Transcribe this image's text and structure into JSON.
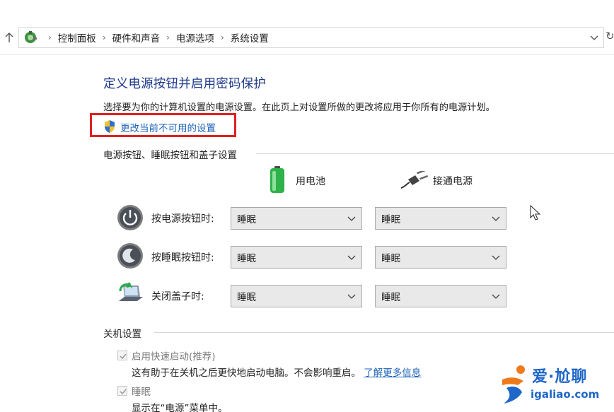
{
  "address_bar": {
    "breadcrumbs": [
      "控制面板",
      "硬件和声音",
      "电源选项",
      "系统设置"
    ]
  },
  "page": {
    "title": "定义电源按钮并启用密码保护",
    "description": "选择要为你的计算机设置的电源设置。在此页上对设置所做的更改将应用于你所有的电源计划。",
    "admin_link": "更改当前不可用的设置"
  },
  "power_buttons": {
    "heading": "电源按钮、睡眠按钮和盖子设置",
    "columns": {
      "battery": "用电池",
      "plugged_in": "接通电源"
    },
    "rows": [
      {
        "label": "按电源按钮时:",
        "battery": "睡眠",
        "plugged_in": "睡眠"
      },
      {
        "label": "按睡眠按钮时:",
        "battery": "睡眠",
        "plugged_in": "睡眠"
      },
      {
        "label": "关闭盖子时:",
        "battery": "睡眠",
        "plugged_in": "睡眠"
      }
    ]
  },
  "shutdown": {
    "heading": "关机设置",
    "fast_startup": {
      "label": "启用快速启动(推荐)",
      "checked": true,
      "desc": "这有助于在关机之后更快地启动电脑。不会影响重启。",
      "link": "了解更多信息"
    },
    "sleep": {
      "label": "睡眠",
      "checked": true,
      "desc": "显示在“电源”菜单中。"
    }
  },
  "watermark": {
    "cn": "爱·尬聊",
    "en": "igaliao.com"
  },
  "colors": {
    "title": "#1e3a8a",
    "link": "#1e63b8",
    "highlight_box": "#e02020"
  }
}
